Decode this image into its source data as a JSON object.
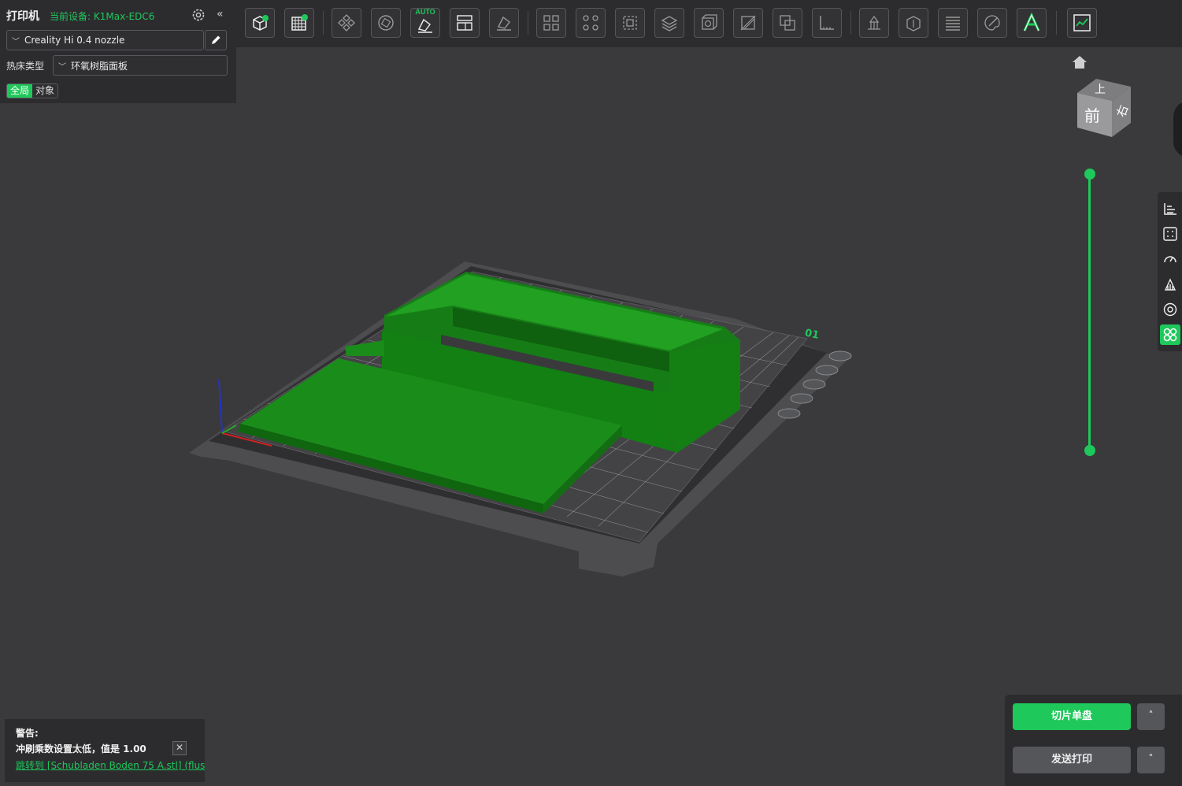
{
  "printer_panel": {
    "title": "打印机",
    "current_device": "当前设备: K1Max-EDC6",
    "nozzle_preset": "Creality Hi 0.4 nozzle",
    "bed_type_label": "热床类型",
    "bed_type_value": "环氧树脂面板",
    "scope_global": "全局",
    "scope_object": "对象"
  },
  "toolbar": {
    "auto_badge": "AUTO",
    "buttons": [
      "add-object",
      "add-plate",
      "arrange",
      "orient",
      "auto-orient",
      "layout",
      "lay-on-face",
      "split-objects",
      "split-parts",
      "bounding-box",
      "support-paint",
      "hollow",
      "cut",
      "boolean",
      "measure",
      "support",
      "seam-paint",
      "layers",
      "color-paint",
      "text",
      "preview"
    ]
  },
  "viewport": {
    "plate_number": "01",
    "view_cube_faces": {
      "top": "上",
      "front": "前",
      "right": "右"
    },
    "model_color": "#1a8c1a",
    "accent": "#1ec85a"
  },
  "warning": {
    "title": "警告:",
    "message": "冲刷乘数设置太低，值是 1.00",
    "link": "跳转到 [Schubladen Boden 75 A.stl] (flus"
  },
  "actions": {
    "slice_label": "切片单盘",
    "send_label": "发送打印",
    "caret": "˄"
  }
}
